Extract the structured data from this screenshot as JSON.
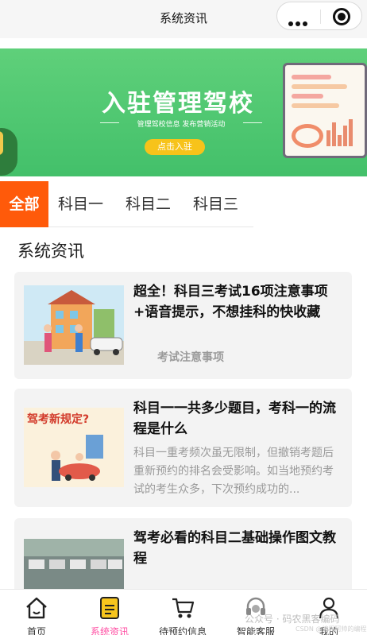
{
  "nav": {
    "title": "系统资讯"
  },
  "banner": {
    "title": "入驻管理驾校",
    "subtitle": "管理驾校信息  发布营销活动",
    "button": "点击入驻"
  },
  "tabs": [
    "全部",
    "科目一",
    "科目二",
    "科目三"
  ],
  "section_title": "系统资讯",
  "articles": [
    {
      "title": "超全！科目三考试16项注意事项+语音提示，不想挂科的快收藏",
      "tag": "考试注意事项"
    },
    {
      "title": "科目一一共多少题目，考科一的流程是什么",
      "desc": "科目一重考频次虽无限制，但撤销考题后重新预约的排名会受影响。如当地预约考试的考生众多，下次预约成功的...",
      "thumb_text": "驾考新规定?"
    },
    {
      "title": "驾考必看的科目二基础操作图文教程"
    }
  ],
  "tabbar": [
    {
      "label": "首页",
      "icon": "home-icon"
    },
    {
      "label": "系统资讯",
      "icon": "document-icon"
    },
    {
      "label": "待预约信息",
      "icon": "cart-icon"
    },
    {
      "label": "智能客服",
      "icon": "headset-icon"
    },
    {
      "label": "我的",
      "icon": "user-icon"
    }
  ],
  "watermark": "公众号 · 码农黑客编码",
  "watermark_sub": "CSDN @编程阿帅的编程",
  "colors": {
    "accent": "#ff5a0a",
    "tab_active": "#ff4fa3",
    "banner": "#4cc46f"
  }
}
